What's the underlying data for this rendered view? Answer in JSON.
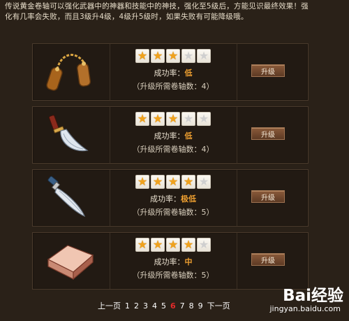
{
  "intro": {
    "line1": "传说黄金卷轴可以强化武器中的神器和技能中的神技，强化至5级后，方能见识最终效果！强",
    "line2": "化有几率会失败，而且3级升4级，4级升5级时，如果失败有可能降级哦。"
  },
  "items": [
    {
      "icon": "nunchaku-icon",
      "stars_filled": 3,
      "stars_total": 5,
      "rate_label": "成功率：",
      "rate_value": "低",
      "req_text": "（升级所需卷轴数：4）",
      "button_label": "升级"
    },
    {
      "icon": "curved-blade-icon",
      "stars_filled": 3,
      "stars_total": 5,
      "rate_label": "成功率：",
      "rate_value": "低",
      "req_text": "（升级所需卷轴数：4）",
      "button_label": "升级"
    },
    {
      "icon": "dagger-icon",
      "stars_filled": 4,
      "stars_total": 5,
      "rate_label": "成功率：",
      "rate_value": "极低",
      "req_text": "（升级所需卷轴数：5）",
      "button_label": "升级"
    },
    {
      "icon": "brick-icon",
      "stars_filled": 4,
      "stars_total": 5,
      "rate_label": "成功率：",
      "rate_value": "中",
      "req_text": "（升级所需卷轴数：5）",
      "button_label": "升级"
    }
  ],
  "pager": {
    "prev": "上一页",
    "pages": [
      "1",
      "2",
      "3",
      "4",
      "5",
      "6",
      "7",
      "8",
      "9"
    ],
    "current": "6",
    "next": "下一页"
  },
  "watermark": {
    "logo": "Bai经验",
    "url": "jingyan.baidu.com"
  },
  "colors": {
    "background": "#2a2118",
    "accent": "#f0a030",
    "current_page": "#e42a2a"
  }
}
